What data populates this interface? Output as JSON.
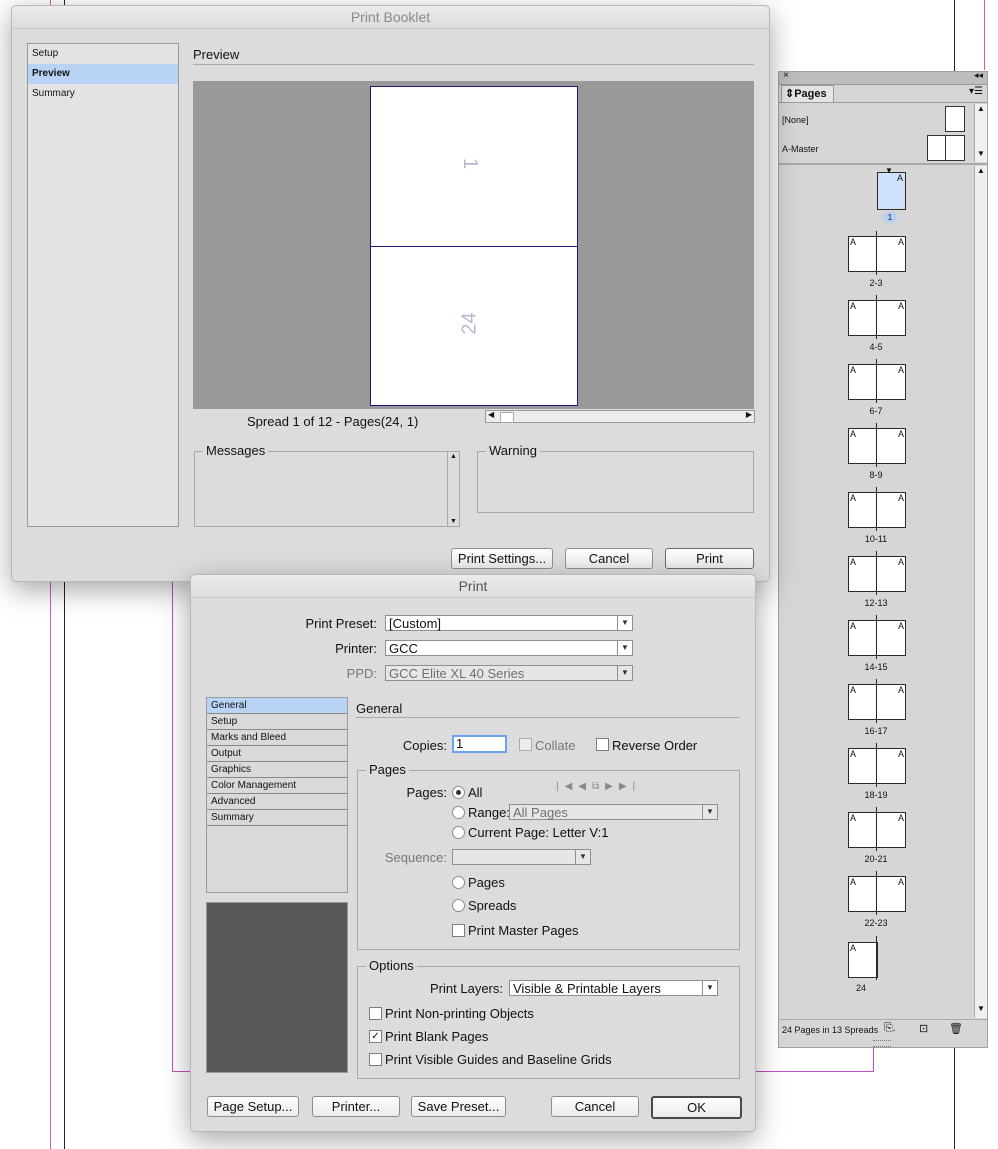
{
  "booklet": {
    "title": "Print Booklet",
    "nav": [
      {
        "label": "Setup"
      },
      {
        "label": "Preview"
      },
      {
        "label": "Summary"
      }
    ],
    "section_title": "Preview",
    "preview_page_top": "1",
    "preview_page_bottom": "24",
    "spread_info": "Spread 1 of 12 - Pages(24, 1)",
    "messages_label": "Messages",
    "warning_label": "Warning",
    "buttons": {
      "print_settings": "Print Settings...",
      "cancel": "Cancel",
      "print": "Print"
    }
  },
  "pages_panel": {
    "tab_label": "Pages",
    "masters": [
      {
        "label": "[None]"
      },
      {
        "label": "A-Master"
      }
    ],
    "first_page_label": "1",
    "master_letter": "A",
    "spreads": [
      {
        "label": "2-3"
      },
      {
        "label": "4-5"
      },
      {
        "label": "6-7"
      },
      {
        "label": "8-9"
      },
      {
        "label": "10-11"
      },
      {
        "label": "12-13"
      },
      {
        "label": "14-15"
      },
      {
        "label": "16-17"
      },
      {
        "label": "18-19"
      },
      {
        "label": "20-21"
      },
      {
        "label": "22-23"
      }
    ],
    "last_page_label": "24",
    "footer_status": "24 Pages in 13 Spreads"
  },
  "print": {
    "title": "Print",
    "preset_label": "Print Preset:",
    "preset_value": "[Custom]",
    "printer_label": "Printer:",
    "printer_value": "GCC",
    "ppd_label": "PPD:",
    "ppd_value": "GCC Elite XL 40 Series",
    "nav": [
      {
        "label": "General"
      },
      {
        "label": "Setup"
      },
      {
        "label": "Marks and Bleed"
      },
      {
        "label": "Output"
      },
      {
        "label": "Graphics"
      },
      {
        "label": "Color Management"
      },
      {
        "label": "Advanced"
      },
      {
        "label": "Summary"
      }
    ],
    "section_title": "General",
    "copies_label": "Copies:",
    "copies_value": "1",
    "collate_label": "Collate",
    "reverse_label": "Reverse Order",
    "pages_group": "Pages",
    "pages_label": "Pages:",
    "all_label": "All",
    "range_label": "Range:",
    "range_value": "All Pages",
    "current_page_label": "Current Page: Letter V:1",
    "sequence_label": "Sequence:",
    "opt_pages": "Pages",
    "opt_spreads": "Spreads",
    "master_pages_label": "Print Master Pages",
    "options_group": "Options",
    "layers_label": "Print Layers:",
    "layers_value": "Visible & Printable Layers",
    "non_printing_label": "Print Non-printing Objects",
    "blank_pages_label": "Print Blank Pages",
    "guides_label": "Print Visible Guides and Baseline Grids",
    "buttons": {
      "page_setup": "Page Setup...",
      "printer": "Printer...",
      "save_preset": "Save Preset...",
      "cancel": "Cancel",
      "ok": "OK"
    }
  }
}
